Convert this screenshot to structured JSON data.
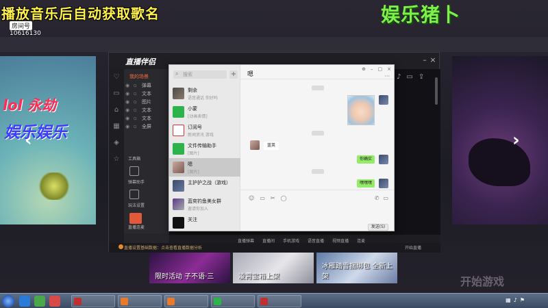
{
  "overlay": {
    "stream_title": "播放音乐后自动获取歌名",
    "room_label": "房间号",
    "room_id": "10616130",
    "brand": "娱乐猪卜",
    "bg_word_1": "",
    "bg_word_2": "开始游戏"
  },
  "left_card": {
    "line1": "lol 永劫",
    "line2": "娱乐娱乐"
  },
  "tiles": [
    {
      "caption": "限时活动 子不语·三"
    },
    {
      "caption": "凌霄宝箱上架"
    },
    {
      "caption": "冰雁踏雪捆绑包 全新上架"
    }
  ],
  "assistant": {
    "logo": "直播伴侣",
    "version": "",
    "panel_heading": "我的场景",
    "sources": [
      {
        "name": "弹幕"
      },
      {
        "name": "文本"
      },
      {
        "name": "图片"
      },
      {
        "name": "文本"
      },
      {
        "name": "文本"
      },
      {
        "name": "全屏"
      }
    ],
    "tool_labels": [
      "工具箱",
      "弹幕助手",
      "玩法设置",
      "直播连麦"
    ],
    "bottom_labels": [
      "直播弹幕",
      "直播间",
      "手机游戏",
      "语音直播",
      "视频直播",
      "连麦"
    ],
    "status_text": "直播设置基础数据：点击查看直播数据分析",
    "status_right": "开始直播"
  },
  "chat": {
    "search_placeholder": "搜索",
    "title": "嗯",
    "conversations": [
      {
        "name": "剩余",
        "preview": "语音通话 你好吗",
        "time": "",
        "avatar": "av-photo"
      },
      {
        "name": "小蒙",
        "preview": "[动画表情]",
        "time": "",
        "avatar": "av-green"
      },
      {
        "name": "订阅号",
        "preview": "新闻资讯 游戏",
        "time": "",
        "avatar": "av-blue"
      },
      {
        "name": "文件传输助手",
        "preview": "[图片]",
        "time": "",
        "avatar": "av-file"
      },
      {
        "name": "嗯",
        "preview": "[图片]",
        "time": "",
        "avatar": "av-girl"
      },
      {
        "name": "主护护之战（游戏）",
        "preview": "",
        "time": "",
        "avatar": "av-dark"
      },
      {
        "name": "蓝奕钓鱼美女群",
        "preview": "邀请你加入",
        "time": "",
        "avatar": "av-game"
      },
      {
        "name": "关注",
        "preview": "",
        "time": "",
        "avatar": "av-black"
      }
    ],
    "messages": {
      "incoming": "蓝英",
      "outgoing_1": "你确实",
      "outgoing_2": "嘿嘿嘿"
    },
    "send_label": "发送(S)"
  },
  "taskbar": {
    "tasks": [
      {
        "label": "",
        "color": "#d0d0d0"
      },
      {
        "label": "",
        "color": "#e87a2a"
      },
      {
        "label": "",
        "color": "#e87a2a"
      },
      {
        "label": "",
        "color": "#2cb34a"
      },
      {
        "label": "",
        "color": "#c03030"
      }
    ],
    "clock_time": "",
    "clock_date": ""
  },
  "colors": {
    "title_yellow": "#fff14a",
    "brand_green": "#7df04a",
    "chat_bubble_green": "#95ec69",
    "accent_orange": "#ff6b3d"
  }
}
